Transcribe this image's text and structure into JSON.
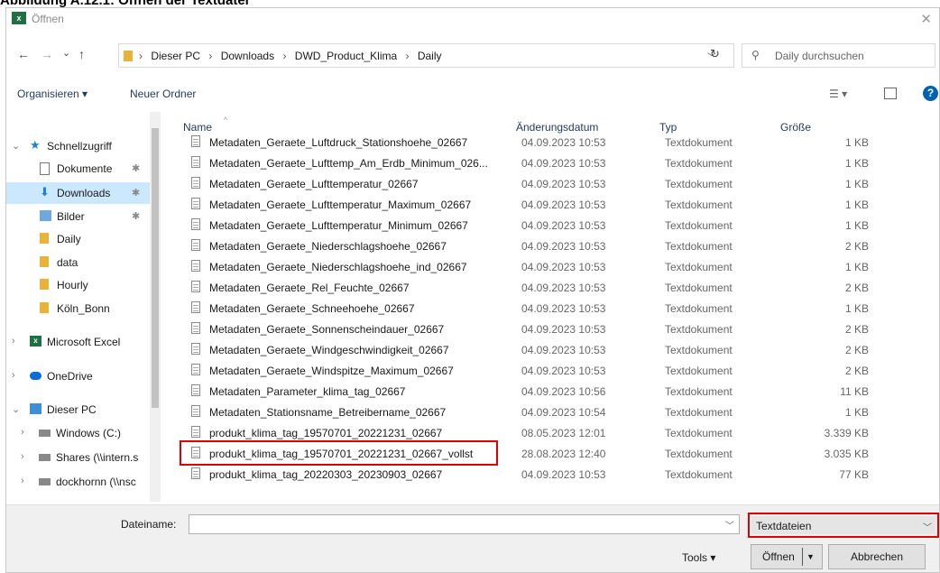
{
  "caption": "Abbildung A.12.1: Öffnen der Textdatei",
  "window": {
    "title": "Öffnen",
    "app_icon": "excel-icon",
    "close": "✕"
  },
  "nav": {
    "back": "←",
    "forward": "→",
    "recent": "⌄",
    "up": "↑"
  },
  "address": {
    "crumbs": [
      "Dieser PC",
      "Downloads",
      "DWD_Product_Klima",
      "Daily"
    ],
    "separator": "›",
    "refresh": "↻"
  },
  "search": {
    "placeholder": "Daily durchsuchen"
  },
  "toolbar": {
    "organize": "Organisieren ▾",
    "new_folder": "Neuer Ordner",
    "help": "?"
  },
  "sidebar": {
    "quick_access": "Schnellzugriff",
    "items": [
      {
        "label": "Dokumente",
        "pinned": true
      },
      {
        "label": "Downloads",
        "pinned": true,
        "selected": true
      },
      {
        "label": "Bilder",
        "pinned": true
      },
      {
        "label": "Daily"
      },
      {
        "label": "data"
      },
      {
        "label": "Hourly"
      },
      {
        "label": "Köln_Bonn"
      }
    ],
    "excel": "Microsoft Excel",
    "onedrive": "OneDrive",
    "this_pc": "Dieser PC",
    "drives": [
      "Windows (C:)",
      "Shares (\\\\intern.s",
      "dockhornn (\\\\nsc"
    ]
  },
  "columns": {
    "name": "Name",
    "date": "Änderungsdatum",
    "type": "Typ",
    "size": "Größe"
  },
  "files": [
    {
      "name": "Metadaten_Geraete_Luftdruck_Stationshoehe_02667",
      "date": "04.09.2023 10:53",
      "type": "Textdokument",
      "size": "1 KB"
    },
    {
      "name": "Metadaten_Geraete_Lufttemp_Am_Erdb_Minimum_026...",
      "date": "04.09.2023 10:53",
      "type": "Textdokument",
      "size": "1 KB"
    },
    {
      "name": "Metadaten_Geraete_Lufttemperatur_02667",
      "date": "04.09.2023 10:53",
      "type": "Textdokument",
      "size": "1 KB"
    },
    {
      "name": "Metadaten_Geraete_Lufttemperatur_Maximum_02667",
      "date": "04.09.2023 10:53",
      "type": "Textdokument",
      "size": "1 KB"
    },
    {
      "name": "Metadaten_Geraete_Lufttemperatur_Minimum_02667",
      "date": "04.09.2023 10:53",
      "type": "Textdokument",
      "size": "1 KB"
    },
    {
      "name": "Metadaten_Geraete_Niederschlagshoehe_02667",
      "date": "04.09.2023 10:53",
      "type": "Textdokument",
      "size": "2 KB"
    },
    {
      "name": "Metadaten_Geraete_Niederschlagshoehe_ind_02667",
      "date": "04.09.2023 10:53",
      "type": "Textdokument",
      "size": "1 KB"
    },
    {
      "name": "Metadaten_Geraete_Rel_Feuchte_02667",
      "date": "04.09.2023 10:53",
      "type": "Textdokument",
      "size": "2 KB"
    },
    {
      "name": "Metadaten_Geraete_Schneehoehe_02667",
      "date": "04.09.2023 10:53",
      "type": "Textdokument",
      "size": "1 KB"
    },
    {
      "name": "Metadaten_Geraete_Sonnenscheindauer_02667",
      "date": "04.09.2023 10:53",
      "type": "Textdokument",
      "size": "2 KB"
    },
    {
      "name": "Metadaten_Geraete_Windgeschwindigkeit_02667",
      "date": "04.09.2023 10:53",
      "type": "Textdokument",
      "size": "2 KB"
    },
    {
      "name": "Metadaten_Geraete_Windspitze_Maximum_02667",
      "date": "04.09.2023 10:53",
      "type": "Textdokument",
      "size": "2 KB"
    },
    {
      "name": "Metadaten_Parameter_klima_tag_02667",
      "date": "04.09.2023 10:56",
      "type": "Textdokument",
      "size": "11 KB"
    },
    {
      "name": "Metadaten_Stationsname_Betreibername_02667",
      "date": "04.09.2023 10:54",
      "type": "Textdokument",
      "size": "1 KB"
    },
    {
      "name": "produkt_klima_tag_19570701_20221231_02667",
      "date": "08.05.2023 12:01",
      "type": "Textdokument",
      "size": "3.339 KB"
    },
    {
      "name": "produkt_klima_tag_19570701_20221231_02667_vollst",
      "date": "28.08.2023 12:40",
      "type": "Textdokument",
      "size": "3.035 KB"
    },
    {
      "name": "produkt_klima_tag_20220303_20230903_02667",
      "date": "04.09.2023 10:53",
      "type": "Textdokument",
      "size": "77 KB"
    }
  ],
  "footer": {
    "filename_label": "Dateiname:",
    "filename_value": "",
    "filter": "Textdateien",
    "tools": "Tools ▾",
    "open": "Öffnen",
    "cancel": "Abbrechen"
  },
  "colors": {
    "highlight": "#e00000",
    "selection": "#cce8ff"
  }
}
